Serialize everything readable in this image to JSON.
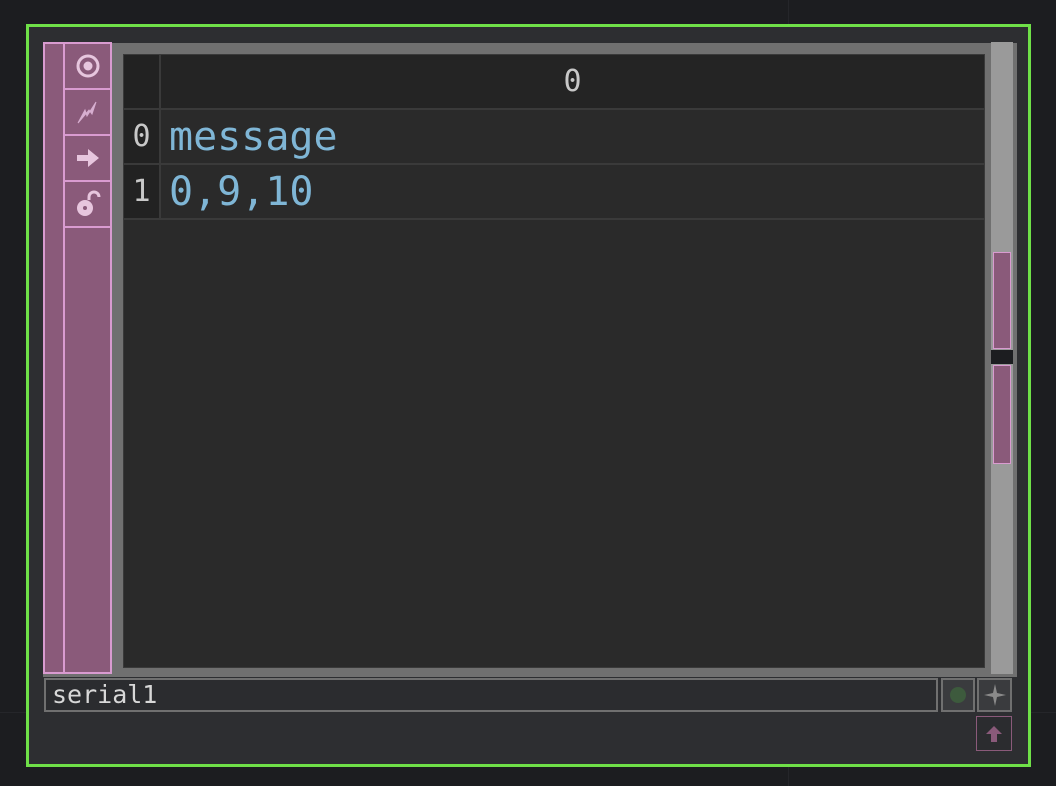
{
  "node": {
    "name": "serial1",
    "border_color": "#6fe048",
    "accent_color": "#8a5a7a"
  },
  "flags": [
    {
      "icon": "viewer-target-icon"
    },
    {
      "icon": "cook-icon"
    },
    {
      "icon": "export-arrow-icon"
    },
    {
      "icon": "lock-icon"
    }
  ],
  "table": {
    "column_header": "0",
    "rows": [
      {
        "index": "0",
        "value": "message"
      },
      {
        "index": "1",
        "value": "0,9,10"
      }
    ]
  },
  "controls": {
    "bypass_icon": "bypass-dot-icon",
    "display_icon": "sparkle-icon",
    "viewer_icon": "pin-up-icon"
  }
}
